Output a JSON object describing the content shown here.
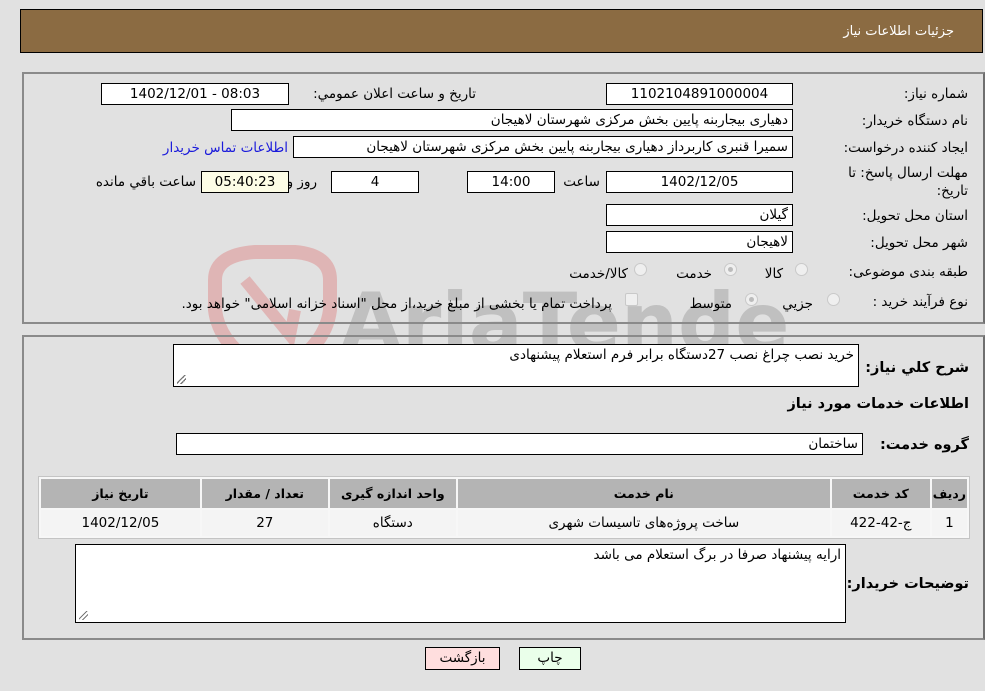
{
  "header": {
    "title": "جزئیات اطلاعات نیاز"
  },
  "form": {
    "need_number": {
      "label": "شماره نیاز:",
      "value": "1102104891000004"
    },
    "announce_datetime": {
      "label": "تاریخ و ساعت اعلان عمومي:",
      "value": "1402/12/01 - 08:03"
    },
    "buyer_org": {
      "label": "نام دستگاه خریدار:",
      "value": "دهیاری بیجاربنه پایین بخش مرکزی شهرستان لاهیجان"
    },
    "requester": {
      "label": "ایجاد کننده درخواست:",
      "value": "سمیرا قنبری کاربرداز دهیاری بیجاربنه پایین بخش مرکزی شهرستان لاهیجان"
    },
    "contact_link": "اطلاعات تماس خریدار",
    "deadline": {
      "label": "مهلت ارسال پاسخ: تا تاریخ:",
      "date": "1402/12/05",
      "time_label": "ساعت",
      "time": "14:00",
      "days": "4",
      "days_label": "روز و",
      "remaining": "05:40:23",
      "remaining_label": "ساعت باقي مانده"
    },
    "province": {
      "label": "استان محل تحویل:",
      "value": "گیلان"
    },
    "city": {
      "label": "شهر محل تحویل:",
      "value": "لاهیجان"
    },
    "category": {
      "label": "طبقه بندی موضوعی:",
      "options": [
        "کالا",
        "خدمت",
        "کالا/خدمت"
      ],
      "selected": "خدمت"
    },
    "purchase_type": {
      "label": "نوع فرآیند خرید :",
      "options": [
        "جزیي",
        "متوسط"
      ],
      "selected": "متوسط",
      "note": "پرداخت تمام یا بخشی از مبلغ خرید،از محل \"اسناد خزانه اسلامی\" خواهد بود."
    }
  },
  "details": {
    "summary_label": "شرح کلي نیاز:",
    "summary": "خرید نصب چراغ نصب 27دستگاه برابر فرم استعلام پیشنهادی",
    "services_title": "اطلاعات خدمات مورد نیاز",
    "service_group_label": "گروه خدمت:",
    "service_group": "ساختمان",
    "table": {
      "headers": [
        "ردیف",
        "کد خدمت",
        "نام خدمت",
        "واحد اندازه گیری",
        "تعداد / مقدار",
        "تاریخ نیاز"
      ],
      "rows": [
        [
          "1",
          "ج-42-422",
          "ساخت پروژه‌های تاسیسات شهری",
          "دستگاه",
          "27",
          "1402/12/05"
        ]
      ]
    },
    "buyer_notes_label": "توضیحات خریدار:",
    "buyer_notes": "ارایه پیشنهاد صرفا در برگ استعلام می باشد"
  },
  "buttons": {
    "print": "چاپ",
    "back": "بازگشت"
  },
  "watermark": "AriaTender.neT",
  "colors": {
    "header_bg": "#8b6b42",
    "print_bg": "#eaffea",
    "back_bg": "#ffdede",
    "link": "#1a1adb"
  }
}
